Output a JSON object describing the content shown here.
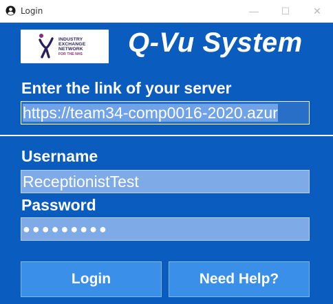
{
  "window": {
    "title": "Login",
    "minimize_glyph": "—",
    "maximize_glyph": "☐",
    "close_glyph": "✕"
  },
  "logo": {
    "icon": "person-icon",
    "line1": "INDUSTRY",
    "line2": "EXCHANGE",
    "line3": "NETWORK",
    "line4": "FOR THE NHS"
  },
  "header": {
    "app_title": "Q-Vu System"
  },
  "server": {
    "label": "Enter the link of your server",
    "value": "https://team34-comp0016-2020.azur"
  },
  "login_form": {
    "username_label": "Username",
    "username_value": "ReceptionistTest",
    "password_label": "Password",
    "password_value": "●●●●●●●●●"
  },
  "buttons": {
    "login": "Login",
    "help": "Need Help?"
  },
  "colors": {
    "background": "#0a5cbf",
    "button": "#3a8fe8",
    "field": "#7eaae8"
  }
}
